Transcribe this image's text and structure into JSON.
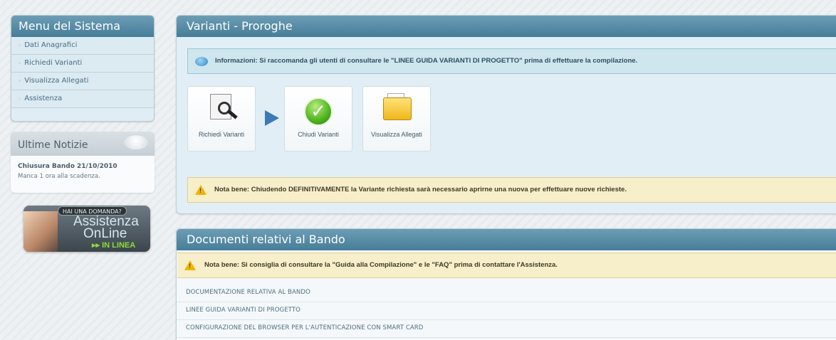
{
  "sidebar": {
    "menu_title": "Menu del Sistema",
    "menu_items": [
      "Dati Anagrafici",
      "Richiedi Varianti",
      "Visualizza Allegati",
      "Assistenza"
    ],
    "news_title": "Ultime Notizie",
    "news_item_title": "Chiusura Bando 21/10/2010",
    "news_item_text": "Manca 1 ora alla scadenza.",
    "assist_pill": "HAI UNA DOMANDA?",
    "assist_line1": "Assistenza",
    "assist_line2": "OnLine",
    "assist_status": "IN LINEA"
  },
  "main": {
    "panel_title": "Varianti - Proroghe",
    "info_text": "Informazioni: Si raccomanda gli utenti di consultare le \"LINEE GUIDA VARIANTI DI PROGETTO\" prima di effettuare la compilazione.",
    "tiles": [
      {
        "label": "Richiedi Varianti",
        "icon": "magnifier-document-icon"
      },
      {
        "label": "Chiudi Varianti",
        "icon": "check-icon"
      },
      {
        "label": "Visualizza Allegati",
        "icon": "folder-icon"
      }
    ],
    "warn_text": "Nota bene: Chiudendo DEFINITIVAMENTE la Variante richiesta sarà necessario aprirne una nuova per effettuare nuove richieste."
  },
  "docs": {
    "panel_title": "Documenti relativi al Bando",
    "warn_text": "Nota bene: Si consiglia di consultare la \"Guida alla Compilazione\" e le \"FAQ\" prima di contattare l'Assistenza.",
    "links": [
      "DOCUMENTAZIONE RELATIVA AL BANDO",
      "LINEE GUIDA VARIANTI DI PROGETTO",
      "CONFIGURAZIONE DEL BROWSER PER L'AUTENTICAZIONE CON SMART CARD"
    ]
  },
  "colors": {
    "header_blue": "#467d98",
    "info_bg": "#cfe6ef",
    "warn_bg": "#f7efca",
    "status_green": "#8ddc3a"
  }
}
